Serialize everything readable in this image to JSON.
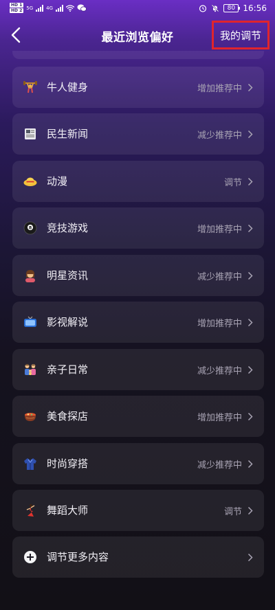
{
  "status_bar": {
    "sim1": "HD 1",
    "sim2": "HD 2",
    "signal1": "5G",
    "signal2": "4G",
    "battery": "80",
    "time": "16:56"
  },
  "nav": {
    "back_icon": "chevron-left-icon",
    "title": "最近浏览偏好",
    "my_adjust": "我的调节",
    "highlight_color": "#e0242c"
  },
  "items": [
    {
      "icon": "weightlifter-icon",
      "label": "牛人健身",
      "status": "增加推荐中"
    },
    {
      "icon": "newspaper-icon",
      "label": "民生新闻",
      "status": "减少推荐中"
    },
    {
      "icon": "straw-hat-icon",
      "label": "动漫",
      "status": "调节"
    },
    {
      "icon": "billiard-8-ball-icon",
      "label": "竞技游戏",
      "status": "增加推荐中"
    },
    {
      "icon": "celebrity-icon",
      "label": "明星资讯",
      "status": "减少推荐中"
    },
    {
      "icon": "tv-icon",
      "label": "影视解说",
      "status": "增加推荐中"
    },
    {
      "icon": "family-icon",
      "label": "亲子日常",
      "status": "减少推荐中"
    },
    {
      "icon": "food-bowl-icon",
      "label": "美食探店",
      "status": "增加推荐中"
    },
    {
      "icon": "jacket-icon",
      "label": "时尚穿搭",
      "status": "减少推荐中"
    },
    {
      "icon": "dancer-icon",
      "label": "舞蹈大师",
      "status": "调节"
    }
  ],
  "more": {
    "icon": "plus-circle-icon",
    "label": "调节更多内容"
  }
}
